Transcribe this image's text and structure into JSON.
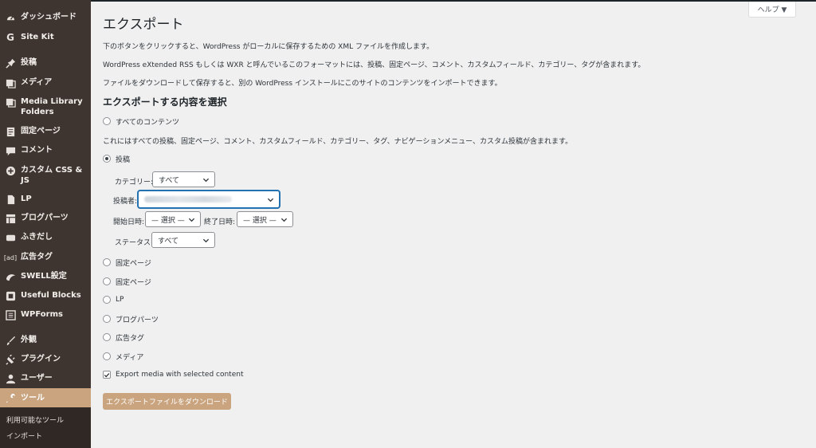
{
  "sidebar": {
    "items": [
      {
        "label": "ダッシュボード",
        "icon": "gauge-icon"
      },
      {
        "label": "Site Kit",
        "icon": "google-g-icon"
      },
      {
        "label": "投稿",
        "icon": "pin-icon"
      },
      {
        "label": "メディア",
        "icon": "media-icon"
      },
      {
        "label": "Media Library Folders",
        "icon": "folder-media-icon"
      },
      {
        "label": "固定ページ",
        "icon": "page-icon"
      },
      {
        "label": "コメント",
        "icon": "comment-icon"
      },
      {
        "label": "カスタム CSS & JS",
        "icon": "plus-circle-icon"
      },
      {
        "label": "LP",
        "icon": "document-icon"
      },
      {
        "label": "ブログパーツ",
        "icon": "grid-icon"
      },
      {
        "label": "ふきだし",
        "icon": "speech-bubble-icon"
      },
      {
        "label": "広告タグ",
        "icon": "ad-icon"
      },
      {
        "label": "SWELL設定",
        "icon": "swell-icon"
      },
      {
        "label": "Useful Blocks",
        "icon": "block-icon"
      },
      {
        "label": "WPForms",
        "icon": "form-icon"
      },
      {
        "label": "外観",
        "icon": "brush-icon"
      },
      {
        "label": "プラグイン",
        "icon": "plug-icon"
      },
      {
        "label": "ユーザー",
        "icon": "user-icon"
      },
      {
        "label": "ツール",
        "icon": "wrench-icon"
      }
    ],
    "submenu": [
      "利用可能なツール",
      "インポート"
    ]
  },
  "help_label": "ヘルプ ▼",
  "page": {
    "title": "エクスポート",
    "p1": "下のボタンをクリックすると、WordPress がローカルに保存するための XML ファイルを作成します。",
    "p2": "WordPress eXtended RSS もしくは WXR と呼んでいるこのフォーマットには、投稿、固定ページ、コメント、カスタムフィールド、カテゴリー、タグが含まれます。",
    "p3": "ファイルをダウンロードして保存すると、別の WordPress インストールにこのサイトのコンテンツをインポートできます。",
    "section_title": "エクスポートする内容を選択",
    "all_content": "すべてのコンテンツ",
    "all_content_desc": "これにはすべての投稿、固定ページ、コメント、カスタムフィールド、カテゴリー、タグ、ナビゲーションメニュー、カスタム投稿が含まれます。",
    "posts": "投稿",
    "filters": {
      "category_label": "カテゴリー:",
      "category_value": "すべて",
      "author_label": "投稿者:",
      "start_label": "開始日時:",
      "start_value": "— 選択 —",
      "end_label": "終了日時:",
      "end_value": "— 選択 —",
      "status_label": "ステータス:",
      "status_value": "すべて"
    },
    "options": [
      "固定ページ",
      "固定ページ",
      "LP",
      "ブログパーツ",
      "広告タグ",
      "メディア"
    ],
    "export_media": "Export media with selected content",
    "download_button": "エクスポートファイルをダウンロード"
  }
}
